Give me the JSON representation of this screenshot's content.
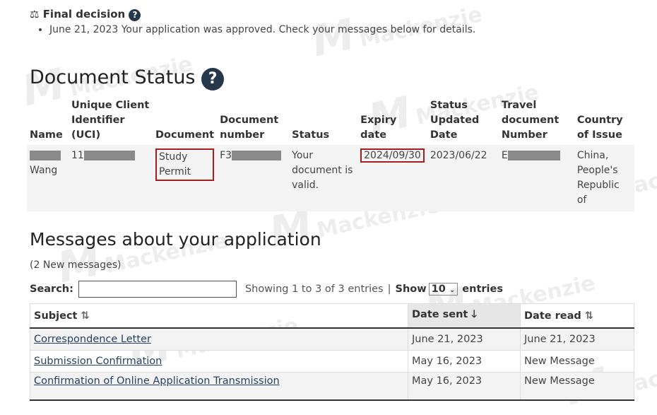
{
  "watermark": "Mackenzie",
  "final_decision": {
    "title": "Final decision",
    "items": [
      "June 21, 2023 Your application was approved. Check your messages below for details."
    ]
  },
  "document_status": {
    "title": "Document Status",
    "headers": [
      "Name",
      "Unique Client Identifier (UCI)",
      "Document",
      "Document number",
      "Status",
      "Expiry date",
      "Status Updated Date",
      "Travel document Number",
      "Country of Issue"
    ],
    "row": {
      "name": "Wang",
      "uci": "11",
      "document": "Study Permit",
      "document_number": "F3",
      "status": "Your document is valid.",
      "expiry": "2024/09/30",
      "updated": "2023/06/22",
      "travel": "E",
      "country": "China, People's Republic of"
    }
  },
  "messages": {
    "title": "Messages about your application",
    "new_count": "(2 New messages)",
    "search_label": "Search:",
    "search_value": "",
    "showing": "Showing 1 to 3 of 3 entries",
    "show_label": "Show",
    "show_value": "10",
    "entries_label": "entries",
    "headers": [
      "Subject",
      "Date sent",
      "Date read"
    ],
    "rows": [
      {
        "subject": "Correspondence Letter",
        "sent": "June 21, 2023",
        "read": "June 21, 2023"
      },
      {
        "subject": "Submission Confirmation",
        "sent": "May 16, 2023",
        "read": "New Message"
      },
      {
        "subject": "Confirmation of Online Application Transmission",
        "sent": "May 16, 2023",
        "read": "New Message"
      }
    ]
  },
  "colors": {
    "accent": "#26374a",
    "highlight": "#a3201d",
    "link": "#284162"
  }
}
